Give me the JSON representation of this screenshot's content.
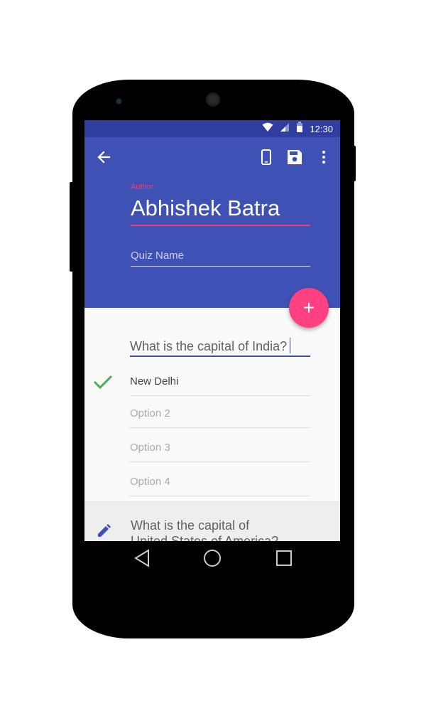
{
  "status_bar": {
    "time": "12:30",
    "icons": [
      "wifi-icon",
      "signal-icon",
      "battery-icon"
    ]
  },
  "toolbar": {
    "icons": [
      "back-arrow-icon",
      "device-preview-icon",
      "save-icon",
      "more-vertical-icon"
    ]
  },
  "author": {
    "label": "Author",
    "value": "Abhishek Batra"
  },
  "quiz_name": {
    "placeholder": "Quiz Name",
    "value": ""
  },
  "fab": {
    "icon": "add-icon",
    "label": "+"
  },
  "question": {
    "text": "What is the capital of India?",
    "options": [
      {
        "text": "New Delhi",
        "is_placeholder": false,
        "correct": true
      },
      {
        "text": "Option 2",
        "is_placeholder": true,
        "correct": false
      },
      {
        "text": "Option 3",
        "is_placeholder": true,
        "correct": false
      },
      {
        "text": "Option 4",
        "is_placeholder": true,
        "correct": false
      }
    ]
  },
  "next_question": {
    "text": "What is the capital of United States of America?",
    "icon": "edit-pencil-icon"
  },
  "nav": {
    "icons": [
      "nav-back-icon",
      "nav-home-icon",
      "nav-recents-icon"
    ]
  },
  "colors": {
    "primary": "#3f51b5",
    "primary_dark": "#303f9f",
    "accent": "#ff4081",
    "correct_check": "#4caf50"
  }
}
